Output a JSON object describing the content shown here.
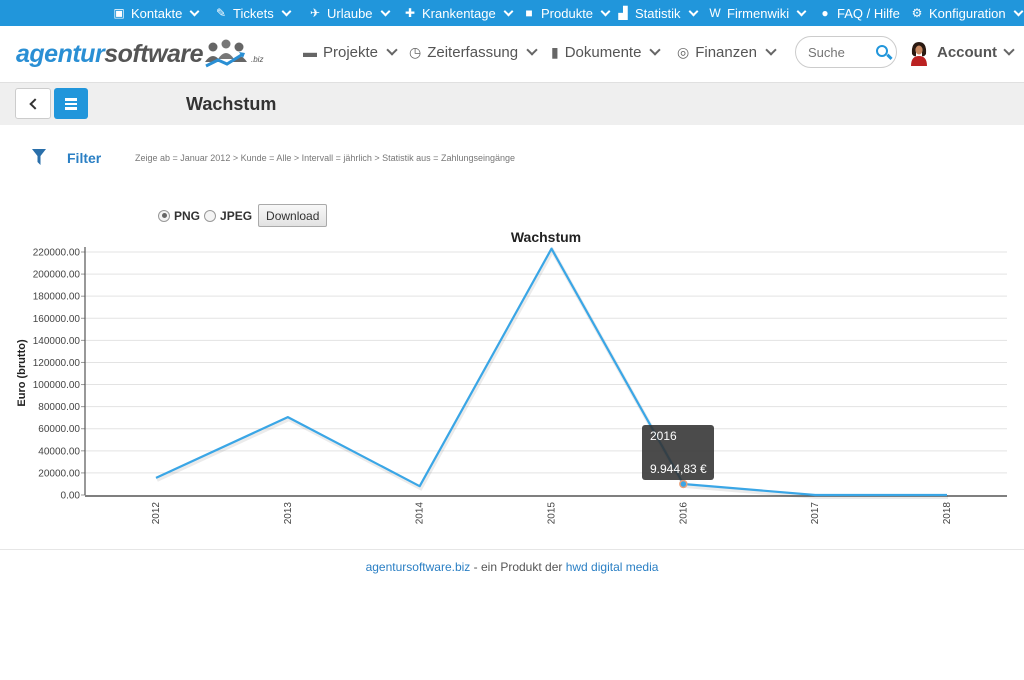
{
  "topbar": {
    "items": [
      {
        "label": "Kontakte",
        "icon": "contact-card-icon",
        "glyph": "▣",
        "dropdown": true
      },
      {
        "label": "Tickets",
        "icon": "ticket-icon",
        "glyph": "✎",
        "dropdown": true
      },
      {
        "label": "Urlaube",
        "icon": "plane-icon",
        "glyph": "✈",
        "dropdown": true
      },
      {
        "label": "Krankentage",
        "icon": "medkit-icon",
        "glyph": "✚",
        "dropdown": true
      },
      {
        "label": "Produkte",
        "icon": "cube-icon",
        "glyph": "■",
        "dropdown": true
      },
      {
        "label": "Statistik",
        "icon": "bar-chart-icon",
        "glyph": "▟",
        "dropdown": true
      },
      {
        "label": "Firmenwiki",
        "icon": "wikipedia-icon",
        "glyph": "W",
        "dropdown": true
      },
      {
        "label": "FAQ / Hilfe",
        "icon": "comment-icon",
        "glyph": "●",
        "dropdown": false
      },
      {
        "label": "Konfiguration",
        "icon": "gears-icon",
        "glyph": "⚙",
        "dropdown": true
      }
    ]
  },
  "header": {
    "logo_part1": "agentur",
    "logo_part2": "software",
    "logo_tld": ".biz",
    "nav": [
      {
        "label": "Projekte",
        "icon": "briefcase-icon",
        "glyph": "▬"
      },
      {
        "label": "Zeiterfassung",
        "icon": "clock-icon",
        "glyph": "◷"
      },
      {
        "label": "Dokumente",
        "icon": "file-icon",
        "glyph": "▮"
      },
      {
        "label": "Finanzen",
        "icon": "coins-icon",
        "glyph": "◎"
      }
    ],
    "search_placeholder": "Suche",
    "account_label": "Account"
  },
  "toolbar": {
    "page_title": "Wachstum"
  },
  "filter": {
    "label": "Filter",
    "summary": "Zeige ab = Januar 2012 > Kunde = Alle > Intervall = jährlich > Statistik aus = Zahlungseingänge"
  },
  "export": {
    "options": [
      "PNG",
      "JPEG"
    ],
    "selected": "PNG",
    "download_label": "Download"
  },
  "chart_data": {
    "type": "line",
    "title": "Wachstum",
    "xlabel": "",
    "ylabel": "Euro (brutto)",
    "categories": [
      "2012",
      "2013",
      "2014",
      "2015",
      "2016",
      "2017",
      "2018"
    ],
    "series": [
      {
        "name": "Zahlungseingänge",
        "color": "#3aa6e6",
        "values": [
          15500,
          70500,
          8000,
          223000,
          9944.83,
          0,
          0
        ]
      }
    ],
    "ylim": [
      0,
      220000
    ],
    "yticks": [
      0,
      20000,
      40000,
      60000,
      80000,
      100000,
      120000,
      140000,
      160000,
      180000,
      200000,
      220000
    ],
    "ytick_labels": [
      "0.00",
      "20000.00",
      "40000.00",
      "60000.00",
      "80000.00",
      "100000.00",
      "120000.00",
      "140000.00",
      "160000.00",
      "180000.00",
      "200000.00",
      "220000.00"
    ],
    "grid": true,
    "legend": "none",
    "tooltip": {
      "category": "2016",
      "value_label": "9.944,83 €"
    }
  },
  "footer": {
    "link1": "agentursoftware.biz",
    "middle": " - ein Produkt der ",
    "link2": "hwd digital media"
  }
}
